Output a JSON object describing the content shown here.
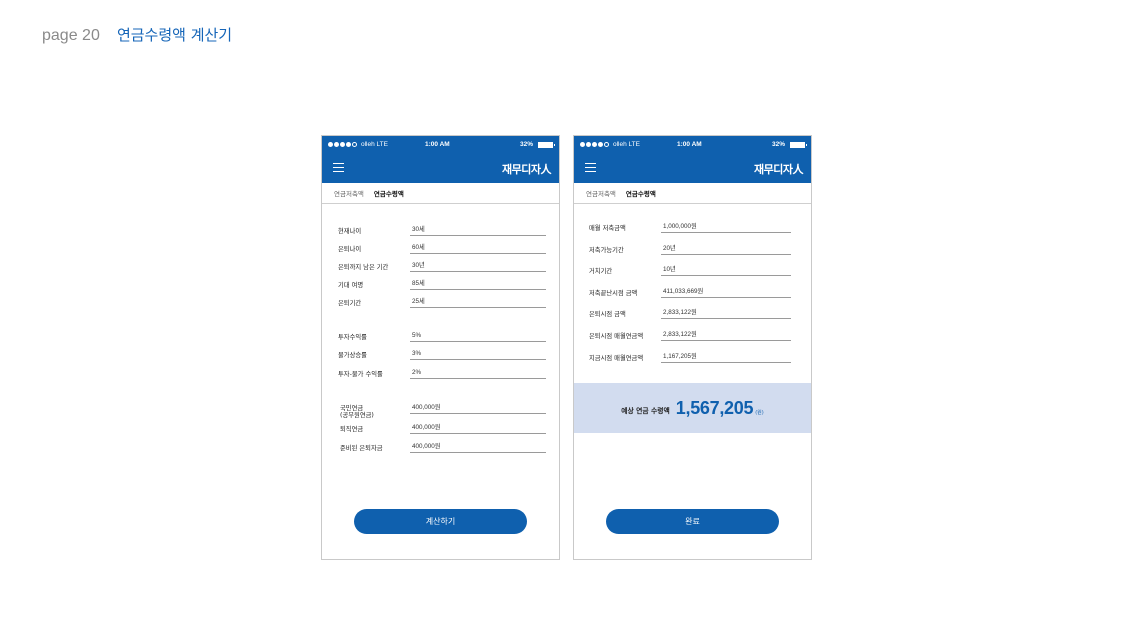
{
  "page": {
    "number": "page 20",
    "title": "연금수령액 계산기"
  },
  "status_bar": {
    "carrier": "olleh LTE",
    "time": "1:00 AM",
    "battery": "32%"
  },
  "brand": "재무디자人",
  "tabs": [
    "연금저축액",
    "연금수령액"
  ],
  "screen1": {
    "fields": [
      {
        "label": "현재나이",
        "value": "30세"
      },
      {
        "label": "은퇴나이",
        "value": "60세"
      },
      {
        "label": "은퇴까지 남은 기간",
        "value": "30년"
      },
      {
        "label": "기대 여명",
        "value": "85세"
      },
      {
        "label": "은퇴기간",
        "value": "25세"
      },
      {
        "label": "투자수익률",
        "value": "5%"
      },
      {
        "label": "물가상승률",
        "value": "3%"
      },
      {
        "label": "투자-물가 수익률",
        "value": "2%"
      },
      {
        "label": "국민연금",
        "label2": "(공무원연금)",
        "value": "400,000원"
      },
      {
        "label": "퇴직연금",
        "value": "400,000원"
      },
      {
        "label": "준비된 은퇴자금",
        "value": "400,000원"
      }
    ],
    "button": "계산하기"
  },
  "screen2": {
    "fields": [
      {
        "label": "매월 저축금액",
        "value": "1,000,000원"
      },
      {
        "label": "저축가능기간",
        "value": "20년"
      },
      {
        "label": "거치기간",
        "value": "10년"
      },
      {
        "label": "저축끝난시점 금액",
        "value": "411,033,669원"
      },
      {
        "label": "은퇴시점 금액",
        "value": "2,833,122원"
      },
      {
        "label": "은퇴시점 매월연금액",
        "value": "2,833,122원"
      },
      {
        "label": "지금시점 매월연금액",
        "value": "1,167,205원"
      }
    ],
    "result": {
      "label": "예상 연금 수령액",
      "value": "1,567,205",
      "unit": "(원)"
    },
    "button": "완료"
  }
}
